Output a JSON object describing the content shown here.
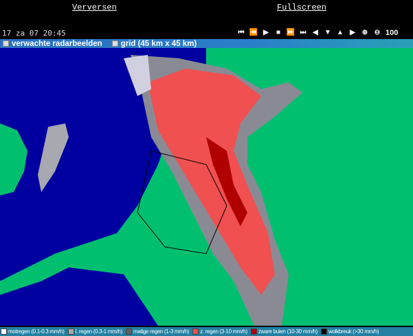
{
  "header": {
    "refresh_label": "Verversen",
    "fullscreen_label": "Fullscreen"
  },
  "timestamp": "17 za 07 20:45",
  "controls": {
    "icons": [
      "first-frame-icon",
      "rewind-icon",
      "play-icon",
      "stop-icon",
      "fast-forward-icon",
      "last-frame-icon",
      "pan-left-icon",
      "pan-down-icon",
      "pan-up-icon",
      "pan-right-icon",
      "zoom-in-icon",
      "zoom-out-icon"
    ],
    "glyphs": [
      "⏮",
      "⏪",
      "▶",
      "■",
      "⏩",
      "⏭",
      "◀",
      "▼",
      "▲",
      "▶",
      "⊕",
      "⊖"
    ],
    "zoom_level": "100"
  },
  "options": [
    {
      "label": "verwachte radarbeelden",
      "checked": false
    },
    {
      "label": "grid (45 km x 45 km)",
      "checked": false
    }
  ],
  "colors": {
    "sea": "#0000a0",
    "land": "#00c070",
    "land_dark": "#00a858",
    "drizzle": "#ffffff",
    "light": "#a8a8b0",
    "moderate": "#707078",
    "heavy": "#f05050",
    "showers": "#b00000",
    "cloudburst": "#000000"
  },
  "legend": [
    {
      "label": "motregen (0.1-0.3 mm/h)",
      "color": "#ffffff"
    },
    {
      "label": "l. regen (0.3-1 mm/h)",
      "color": "#a8a8a8"
    },
    {
      "label": "matige regen (1-3 mm/h)",
      "color": "#606060"
    },
    {
      "label": "z. regen (3-10 mm/h)",
      "color": "#f05050"
    },
    {
      "label": "zware buien (10-30 mm/h)",
      "color": "#b00000"
    },
    {
      "label": "wolkbreuk (>30 mm/h)",
      "color": "#000000"
    }
  ]
}
